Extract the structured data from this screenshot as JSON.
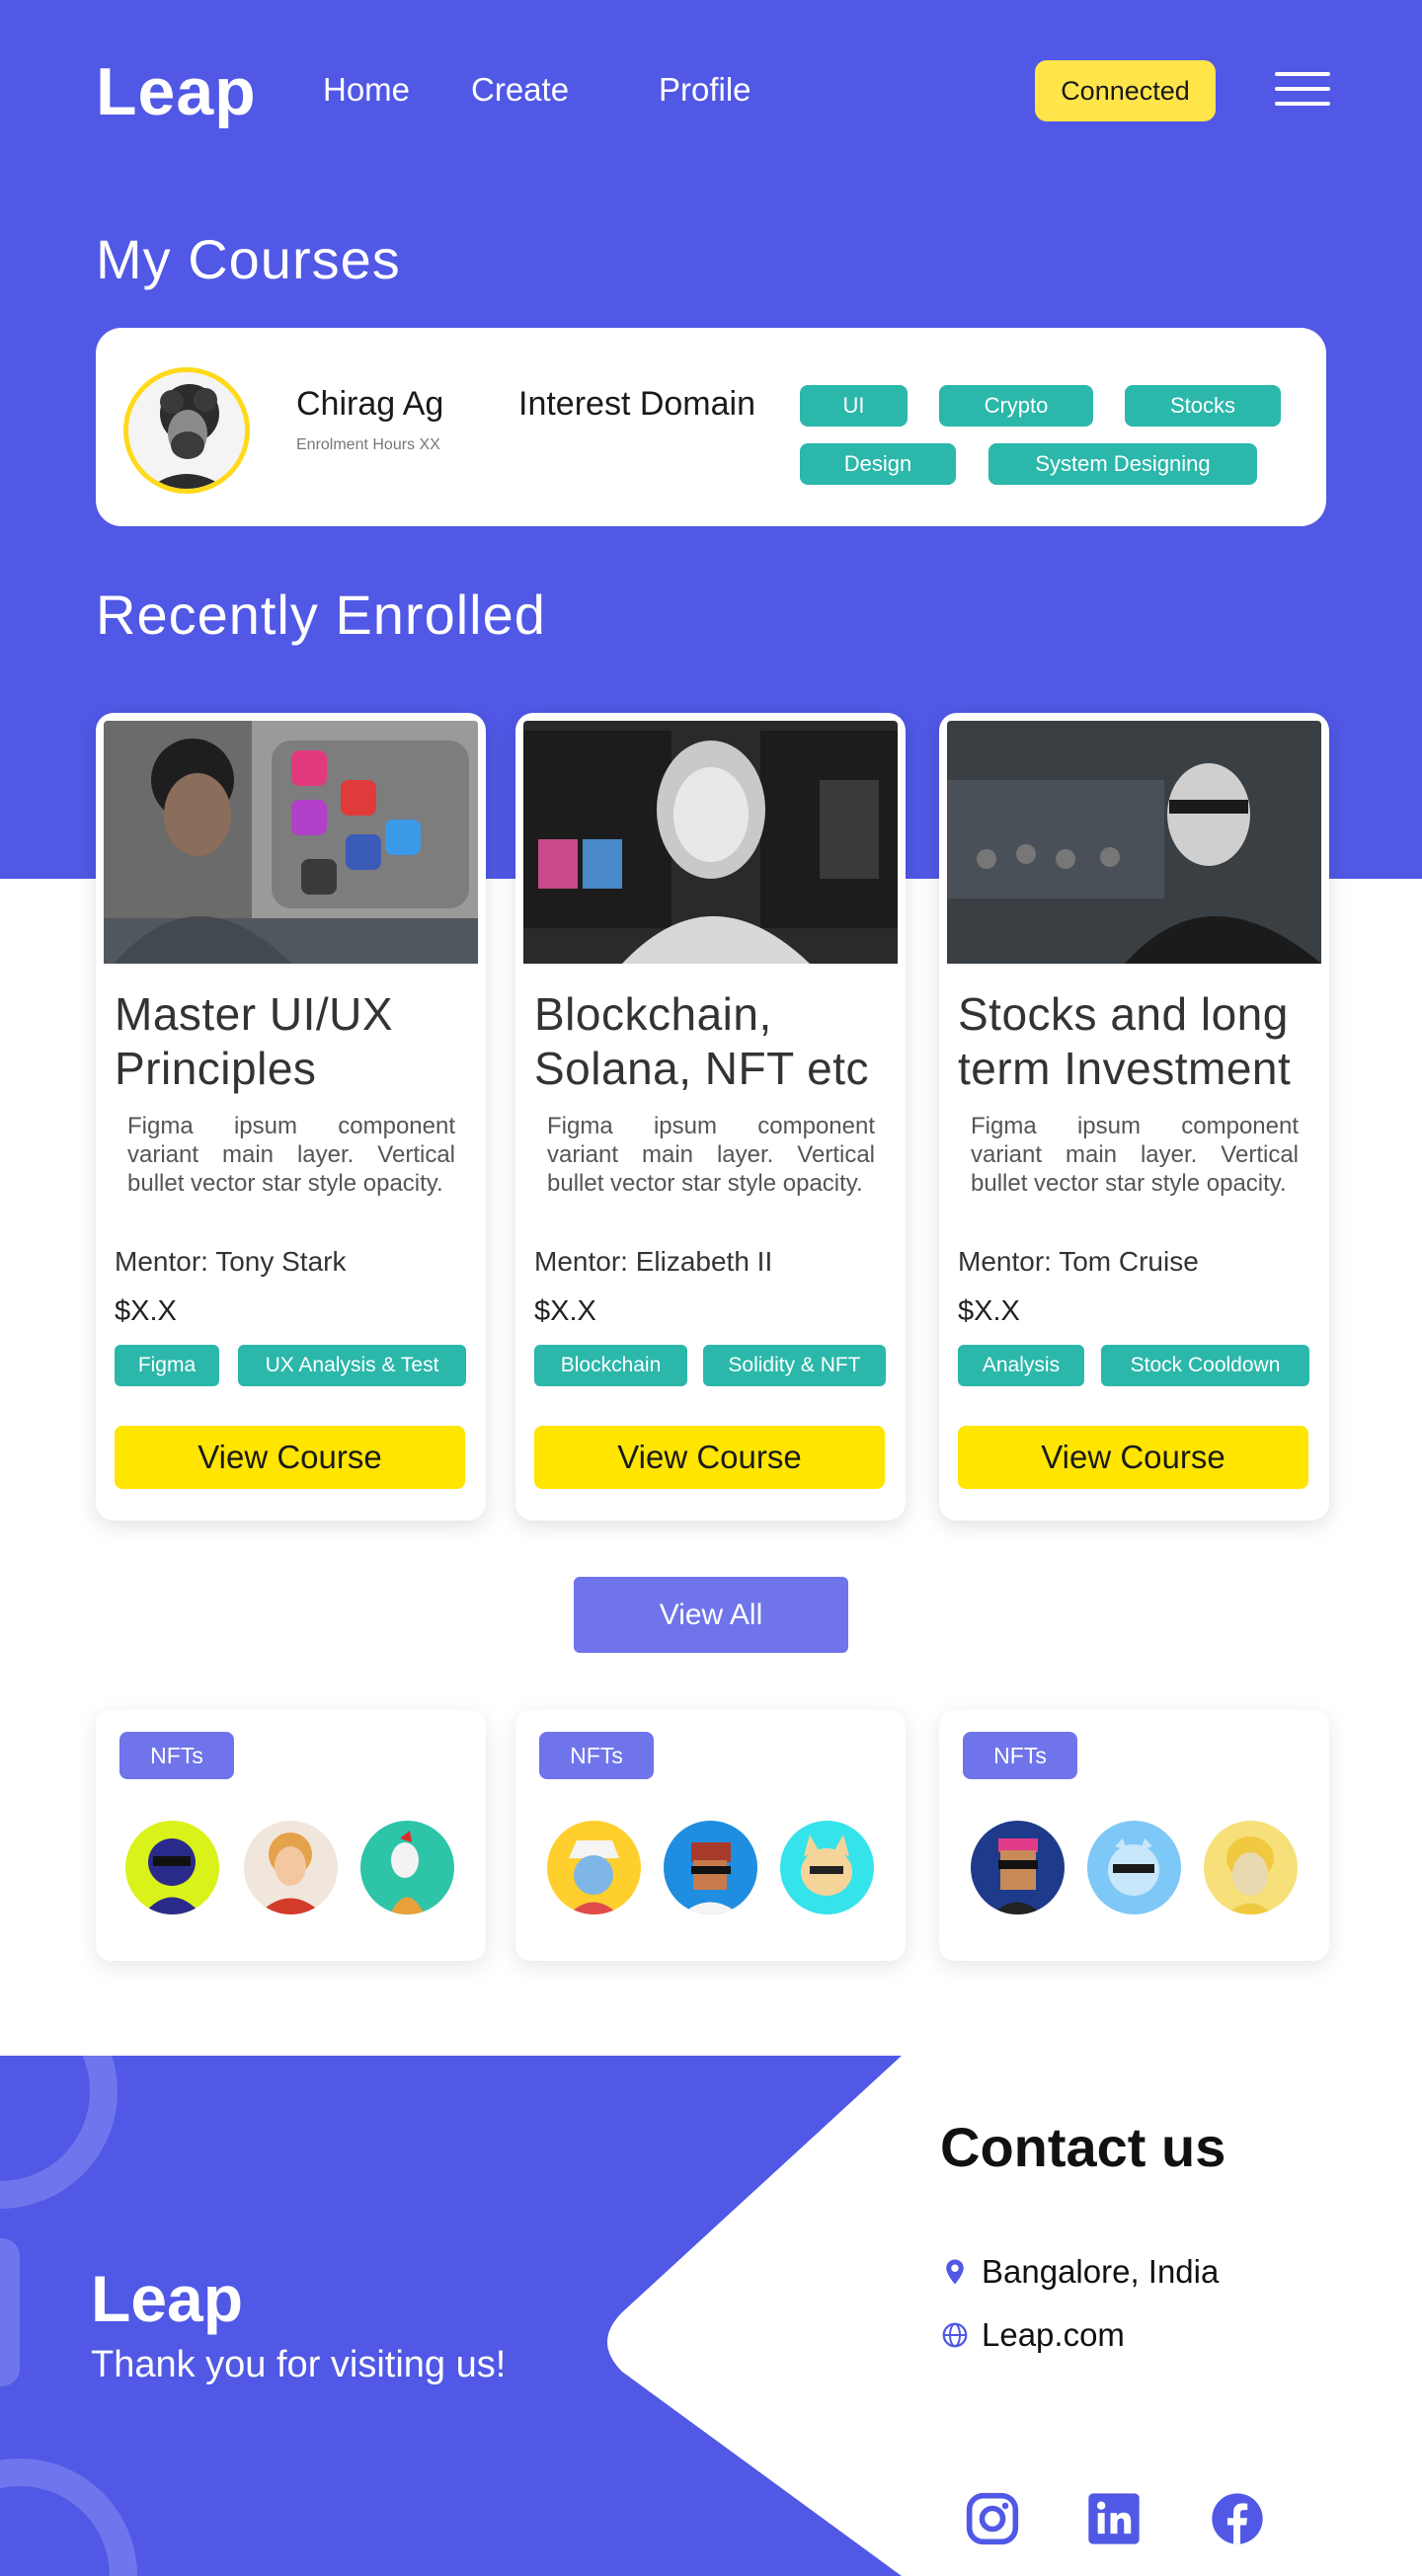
{
  "brand": {
    "name": "Leap",
    "primary_color": "#5058e5",
    "accent_yellow": "#ffe500",
    "teal": "#2bb7aa"
  },
  "nav": {
    "links": [
      "Home",
      "Create",
      "Profile"
    ],
    "connected_label": "Connected",
    "menu_icon": "hamburger-menu-icon"
  },
  "my_courses": {
    "title": "My Courses",
    "user": {
      "name": "Chirag Ag",
      "hours": "Enrolment Hours XX"
    },
    "domain_label": "Interest Domain",
    "domains": [
      "UI",
      "Crypto",
      "Stocks",
      "Design",
      "System Designing"
    ]
  },
  "recent": {
    "title": "Recently Enrolled",
    "courses": [
      {
        "title": "Master UI/UX Principles",
        "desc": "Figma ipsum component variant main layer. Vertical bullet vector star style opacity.",
        "mentor": "Mentor: Tony Stark",
        "price": "$X.X",
        "tags": [
          "Figma",
          "UX Analysis & Test"
        ],
        "button": "View Course"
      },
      {
        "title": "Blockchain, Solana, NFT etc",
        "desc": "Figma ipsum component variant main layer. Vertical bullet vector star style opacity.",
        "mentor": "Mentor: Elizabeth II",
        "price": "$X.X",
        "tags": [
          "Blockchain",
          "Solidity & NFT"
        ],
        "button": "View Course"
      },
      {
        "title": "Stocks and long term Investment",
        "desc": "Figma ipsum component variant main layer. Vertical bullet vector star style opacity.",
        "mentor": "Mentor: Tom Cruise",
        "price": "$X.X",
        "tags": [
          "Analysis",
          "Stock Cooldown"
        ],
        "button": "View Course"
      }
    ],
    "view_all": "View All"
  },
  "nfts": {
    "label": "NFTs",
    "avatar_colors": [
      [
        "#d9f21a",
        "#f1e6dc",
        "#2ec4a8"
      ],
      [
        "#ffcf2e",
        "#1f8de0",
        "#35e3ea"
      ],
      [
        "#1e3a8a",
        "#7ec8f7",
        "#f7e07a"
      ]
    ]
  },
  "footer": {
    "brand": "Leap",
    "thanks": "Thank you for visiting us!",
    "contact_title": "Contact us",
    "location": "Bangalore, India",
    "website": "Leap.com",
    "socials": [
      "instagram-icon",
      "linkedin-icon",
      "facebook-icon"
    ]
  }
}
